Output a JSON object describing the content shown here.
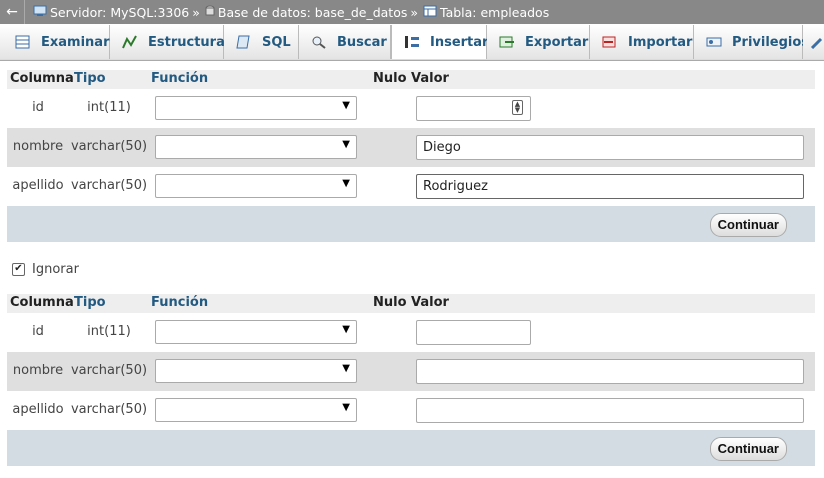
{
  "breadcrumb": {
    "back_icon": "arrow-left-icon",
    "server": "Servidor: MySQL:3306",
    "database": "Base de datos: base_de_datos",
    "table": "Tabla: empleados",
    "separator": "»"
  },
  "tabs": [
    {
      "label": "Examinar",
      "icon": "table-icon"
    },
    {
      "label": "Estructura",
      "icon": "structure-icon"
    },
    {
      "label": "SQL",
      "icon": "sql-icon"
    },
    {
      "label": "Buscar",
      "icon": "search-icon"
    },
    {
      "label": "Insertar",
      "icon": "insert-icon",
      "active": true
    },
    {
      "label": "Exportar",
      "icon": "export-icon"
    },
    {
      "label": "Importar",
      "icon": "import-icon"
    },
    {
      "label": "Privilegios",
      "icon": "privileges-icon"
    }
  ],
  "headers": {
    "columna": "Columna",
    "tipo": "Tipo",
    "funcion": "Función",
    "nulo": "Nulo",
    "valor": "Valor"
  },
  "form1": {
    "rows": [
      {
        "name": "id",
        "type": "int(11)",
        "value": ""
      },
      {
        "name": "nombre",
        "type": "varchar(50)",
        "value": "Diego"
      },
      {
        "name": "apellido",
        "type": "varchar(50)",
        "value": "Rodriguez"
      }
    ],
    "button": "Continuar"
  },
  "ignore": {
    "label": "Ignorar",
    "checked": true
  },
  "form2": {
    "rows": [
      {
        "name": "id",
        "type": "int(11)",
        "value": ""
      },
      {
        "name": "nombre",
        "type": "varchar(50)",
        "value": ""
      },
      {
        "name": "apellido",
        "type": "varchar(50)",
        "value": ""
      }
    ],
    "button": "Continuar"
  },
  "colors": {
    "header_bg": "#888888",
    "link": "#235a81",
    "footer_bg": "#d3dce3",
    "alt_row": "#dfdfdf"
  }
}
